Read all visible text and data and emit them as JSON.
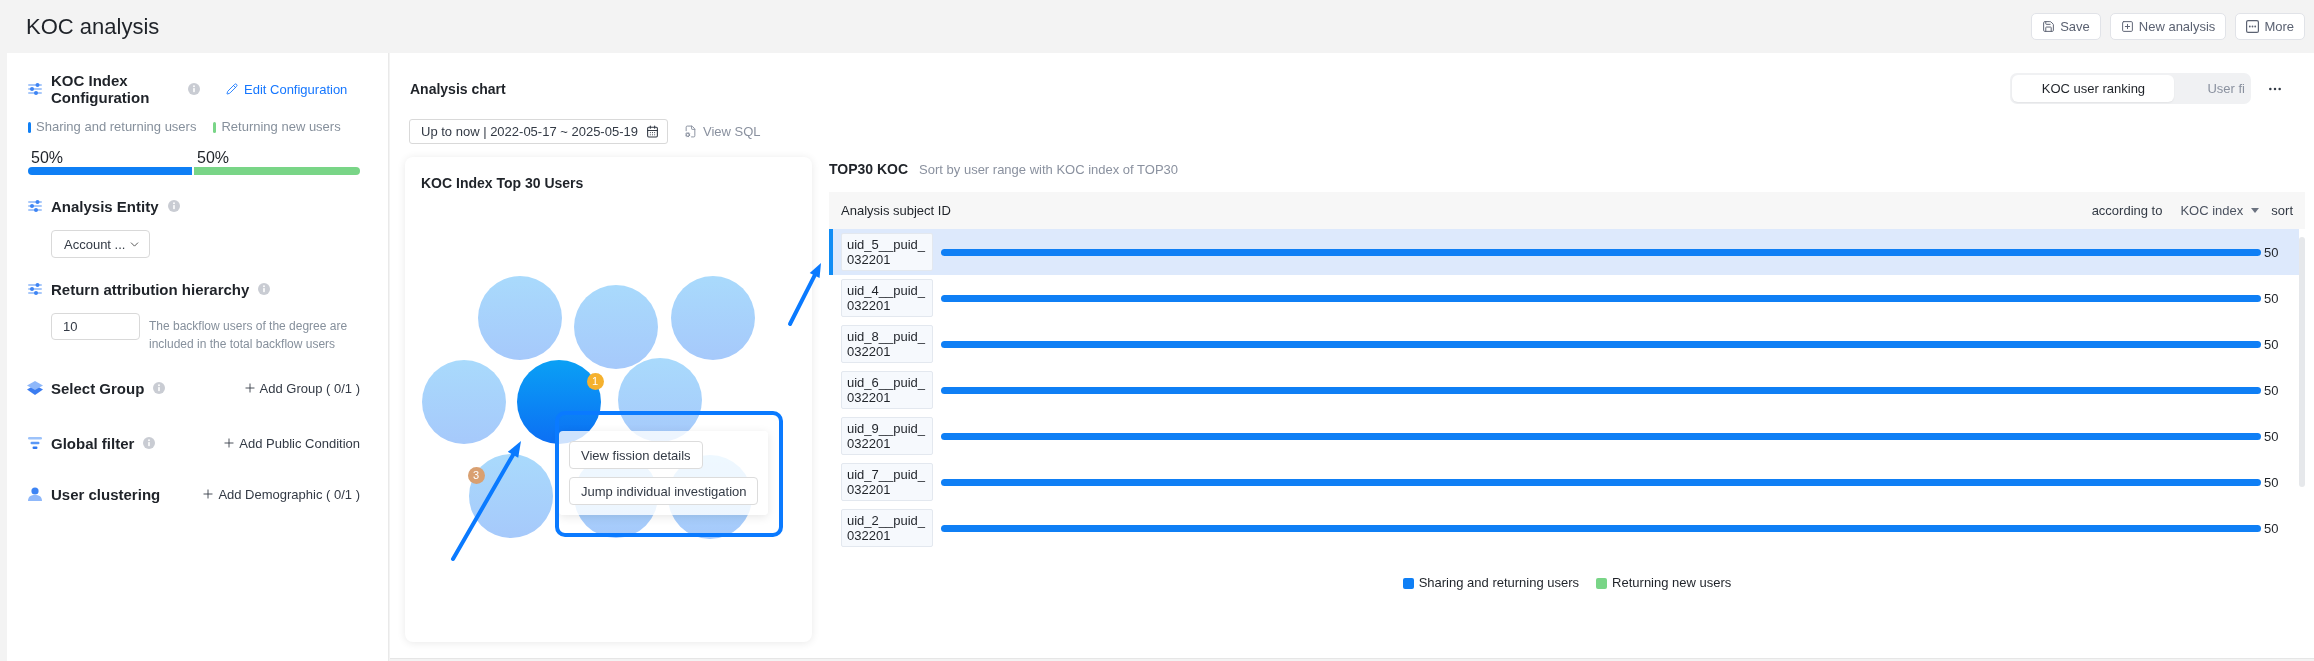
{
  "header": {
    "title": "KOC analysis",
    "actions": [
      {
        "kind": "save",
        "label": "Save"
      },
      {
        "kind": "new",
        "label": "New analysis"
      },
      {
        "kind": "more",
        "label": "More"
      }
    ]
  },
  "config": {
    "sections": [
      {
        "kind": "weights",
        "title": "KOC Index Configuration",
        "info": true,
        "edit_link": "Edit Configuration",
        "weights": [
          {
            "label": "Sharing and returning users",
            "color": "#0f7ff5",
            "percent": "50%",
            "level": 0.5
          },
          {
            "label": "Returning new users",
            "color": "#79d587",
            "percent": "50%",
            "level": 0.5
          }
        ]
      },
      {
        "kind": "entity",
        "title": "Analysis Entity",
        "info": true,
        "select": {
          "value": "Account ..."
        }
      },
      {
        "kind": "hierarchy",
        "title": "Return attribution hierarchy",
        "info": true,
        "input": {
          "value": "10"
        },
        "note": "The backflow users of the degree are included in the total backflow users"
      },
      {
        "kind": "group",
        "title": "Select Group",
        "info": true,
        "add_label": "Add Group ( 0/1 )"
      },
      {
        "kind": "filter",
        "title": "Global filter",
        "info": true,
        "add_label": "Add Public Condition"
      },
      {
        "kind": "clustering",
        "title": "User clustering",
        "info": false,
        "add_label": "Add Demographic ( 0/1 )"
      }
    ]
  },
  "analysis": {
    "title": "Analysis chart",
    "view_tabs": [
      {
        "label": "KOC user ranking",
        "selected": true
      },
      {
        "label": "User fi",
        "selected": false
      }
    ],
    "date_range": {
      "value": "Up to now | 2022-05-17 ~ 2025-05-19"
    },
    "view_sql": "View SQL",
    "bubble_card": {
      "title": "KOC Index Top 30 Users",
      "bubbles": [
        {
          "selected": false
        },
        {
          "selected": false
        },
        {
          "selected": false
        },
        {
          "selected": false
        },
        {
          "selected": true,
          "badge": {
            "text": "1",
            "color": "#f5b12e"
          }
        },
        {
          "selected": false
        },
        {
          "selected": false,
          "badge": {
            "text": "3",
            "color": "#d9a071"
          }
        },
        {
          "selected": false
        },
        {
          "selected": false
        }
      ],
      "menu": [
        "View fission details",
        "Jump individual investigation"
      ]
    },
    "ranking": {
      "title": "TOP30 KOC",
      "subtitle": "Sort by user range with KOC index of TOP30",
      "column": "Analysis subject ID",
      "sort": {
        "label": "according to",
        "field": "KOC index",
        "suffix": "sort"
      },
      "rows": [
        {
          "selected": true
        },
        {
          "selected": false
        },
        {
          "selected": false
        },
        {
          "selected": false
        },
        {
          "selected": false
        },
        {
          "selected": false
        },
        {
          "selected": false
        }
      ],
      "chart_data": {
        "type": "bar",
        "orientation": "horizontal",
        "data_labels": true,
        "categories": [
          "uid_5__puid_032201",
          "uid_4__puid_032201",
          "uid_8__puid_032201",
          "uid_6__puid_032201",
          "uid_9__puid_032201",
          "uid_7__puid_032201",
          "uid_2__puid_032201"
        ],
        "series": [
          {
            "name": "Sharing and returning users",
            "color": "#0f7ff5",
            "values": [
              50,
              50,
              50,
              50,
              50,
              50,
              50
            ]
          },
          {
            "name": "Returning new users",
            "color": "#79d587",
            "values": [
              null,
              null,
              null,
              null,
              null,
              null,
              null
            ]
          }
        ]
      }
    }
  }
}
